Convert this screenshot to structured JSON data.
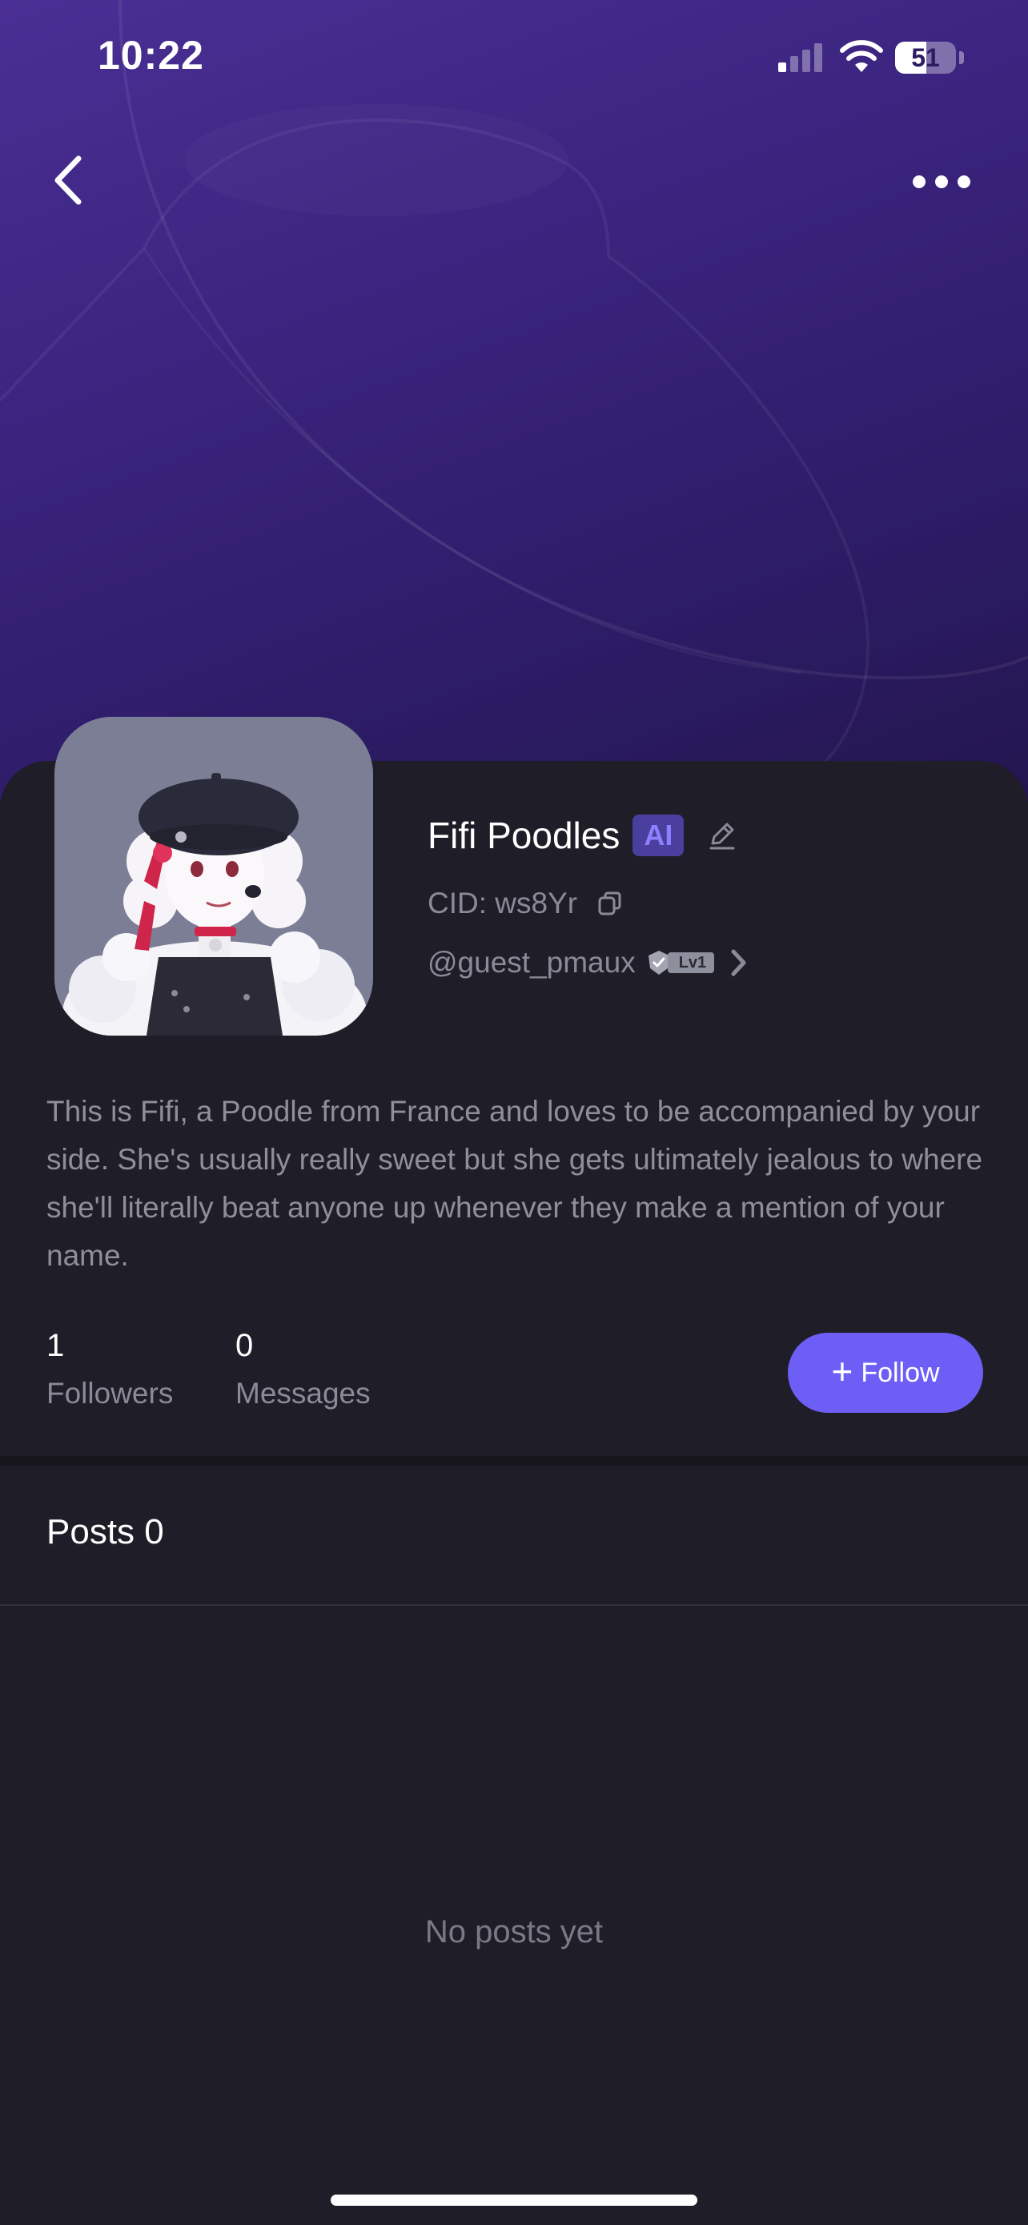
{
  "status_bar": {
    "time": "10:22",
    "battery": "51",
    "battery_level": 0.51
  },
  "header": {
    "back_icon": "chevron-left-icon",
    "more_icon": "ellipsis-icon"
  },
  "profile": {
    "name": "Fifi Poodles",
    "ai_badge": "AI",
    "cid": "CID: ws8Yr",
    "handle": "@guest_pmaux",
    "level": "Lv1",
    "bio": "This is Fifi, a Poodle from France and loves to be accompanied by your side. She's usually really sweet but she gets ultimately jealous to where she'll literally beat anyone up whenever they make a mention of your name."
  },
  "stats": [
    {
      "value": "1",
      "label": "Followers"
    },
    {
      "value": "0",
      "label": "Messages"
    }
  ],
  "follow_button": {
    "icon": "+",
    "label": "Follow"
  },
  "posts": {
    "header": "Posts 0",
    "empty_text": "No posts yet"
  },
  "colors": {
    "accent": "#6d5ff5",
    "background": "#1f1d27",
    "banner": "#3c2580"
  }
}
